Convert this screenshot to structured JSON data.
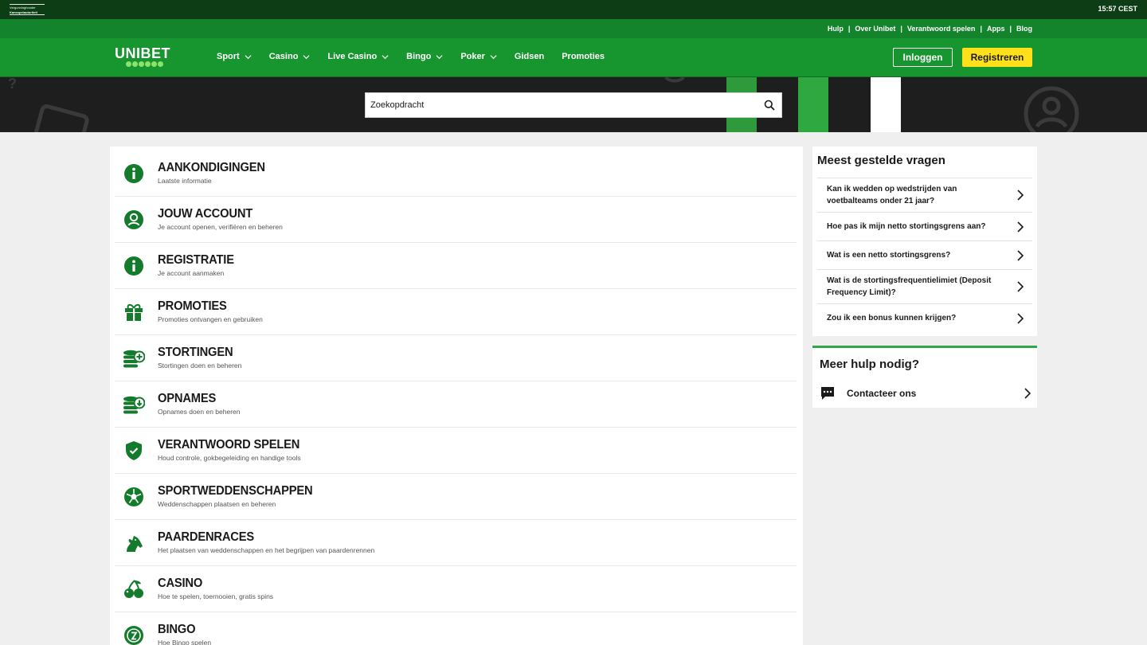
{
  "topbar": {
    "license_line1": "Vergunninghouder",
    "license_line2": "Kansspelautoriteit",
    "time": "15:57 CEST"
  },
  "utility_links": [
    "Hulp",
    "Over Unibet",
    "Verantwoord spelen",
    "Apps",
    "Blog"
  ],
  "brand": {
    "logo_text": "UNIBET"
  },
  "nav": {
    "items": [
      {
        "label": "Sport",
        "dropdown": true
      },
      {
        "label": "Casino",
        "dropdown": true
      },
      {
        "label": "Live Casino",
        "dropdown": true
      },
      {
        "label": "Bingo",
        "dropdown": true
      },
      {
        "label": "Poker",
        "dropdown": true
      },
      {
        "label": "Gidsen",
        "dropdown": false
      },
      {
        "label": "Promoties",
        "dropdown": false
      }
    ],
    "login_label": "Inloggen",
    "register_label": "Registreren"
  },
  "search": {
    "placeholder": "Zoekopdracht"
  },
  "categories": [
    {
      "title": "Aankondigingen",
      "subtitle": "Laatste informatie",
      "icon": "info-icon"
    },
    {
      "title": "Jouw account",
      "subtitle": "Je account openen, verifiëren en beheren",
      "icon": "user-icon"
    },
    {
      "title": "Registratie",
      "subtitle": "Je account aanmaken",
      "icon": "info-icon"
    },
    {
      "title": "Promoties",
      "subtitle": "Promoties ontvangen en gebruiken",
      "icon": "gift-icon"
    },
    {
      "title": "Stortingen",
      "subtitle": "Stortingen doen en beheren",
      "icon": "coins-plus-icon"
    },
    {
      "title": "Opnames",
      "subtitle": "Opnames doen en beheren",
      "icon": "coins-down-icon"
    },
    {
      "title": "Verantwoord spelen",
      "subtitle": "Houd controle, gokbegeleiding en handige tools",
      "icon": "shield-check-icon"
    },
    {
      "title": "Sportweddenschappen",
      "subtitle": "Weddenschappen plaatsen en beheren",
      "icon": "football-icon"
    },
    {
      "title": "Paardenraces",
      "subtitle": "Het plaatsen van weddenschappen en het begrijpen van paardenrennen",
      "icon": "horse-icon"
    },
    {
      "title": "Casino",
      "subtitle": "Hoe te spelen, toernooien, gratis spins",
      "icon": "cherries-icon"
    },
    {
      "title": "Bingo",
      "subtitle": "Hoe Bingo spelen",
      "icon": "bingo-ball-icon"
    }
  ],
  "faq": {
    "heading": "Meest gestelde vragen",
    "items": [
      "Kan ik wedden op wedstrijden van voetbalteams onder 21 jaar?",
      "Hoe pas ik mijn netto stortingsgrens aan?",
      "Wat is een netto stortingsgrens?",
      "Wat is de stortingsfrequentielimiet (Deposit Frequency Limit)?",
      "Zou ik een bonus kunnen krijgen?"
    ]
  },
  "help": {
    "heading": "Meer hulp nodig?",
    "contact_label": "Contacteer ons"
  },
  "colors": {
    "brand_green": "#17962f",
    "dark_green": "#0c3d14",
    "icon_green": "#147b2c",
    "register_yellow": "#ffe01b"
  }
}
